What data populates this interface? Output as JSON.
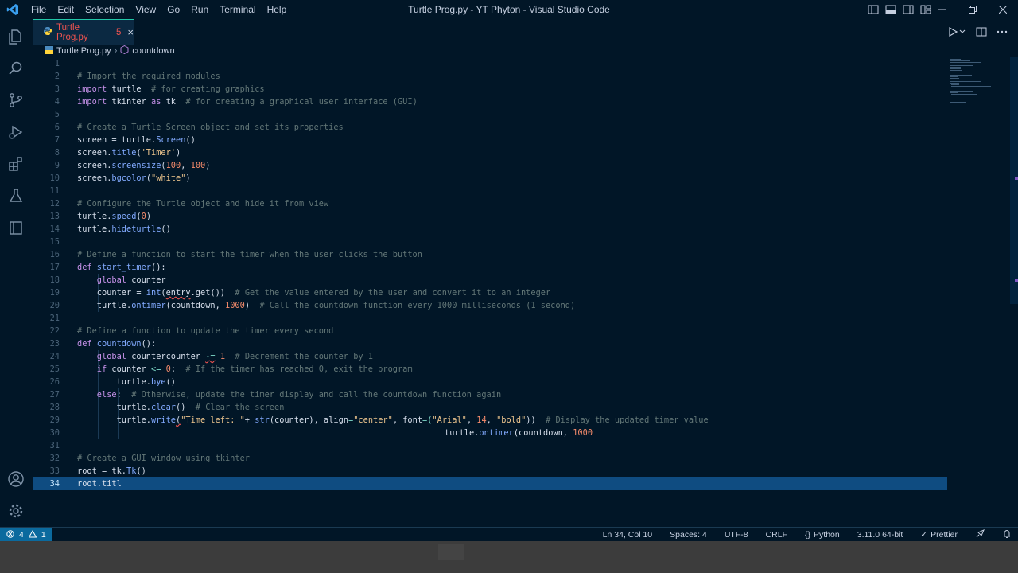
{
  "titlebar": {
    "menu": [
      "File",
      "Edit",
      "Selection",
      "View",
      "Go",
      "Run",
      "Terminal",
      "Help"
    ],
    "window_title": "Turtle Prog.py - YT Phyton - Visual Studio Code"
  },
  "tab": {
    "label": "Turtle Prog.py",
    "problems": "5"
  },
  "breadcrumb": {
    "file": "Turtle Prog.py",
    "symbol": "countdown"
  },
  "editor": {
    "line_numbers": [
      "1",
      "2",
      "3",
      "4",
      "5",
      "6",
      "7",
      "8",
      "9",
      "10",
      "11",
      "12",
      "13",
      "14",
      "15",
      "16",
      "17",
      "18",
      "19",
      "20",
      "21",
      "22",
      "23",
      "24",
      "25",
      "26",
      "27",
      "28",
      "29",
      "30",
      "31",
      "32",
      "33",
      "34"
    ],
    "lines": {
      "l2": "# Import the required modules",
      "l3a": "import",
      "l3b": " turtle ",
      "l3c": " # for creating graphics",
      "l4a": "import",
      "l4b": " tkinter ",
      "l4c": "as",
      "l4d": " tk ",
      "l4e": " # for creating a graphical user interface (GUI)",
      "l6": "# Create a Turtle Screen object and set its properties",
      "l7a": "screen = turtle.",
      "l7b": "Screen",
      "l7c": "()",
      "l8a": "screen.",
      "l8b": "title",
      "l8c": "(",
      "l8d": "'Timer'",
      "l8e": ")",
      "l9a": "screen.",
      "l9b": "screensize",
      "l9c": "(",
      "l9d": "100",
      "l9e": ", ",
      "l9f": "100",
      "l9g": ")",
      "l10a": "screen.",
      "l10b": "bgcolor",
      "l10c": "(",
      "l10d": "\"white\"",
      "l10e": ")",
      "l12": "# Configure the Turtle object and hide it from view",
      "l13a": "turtle.",
      "l13b": "speed",
      "l13c": "(",
      "l13d": "0",
      "l13e": ")",
      "l14a": "turtle.",
      "l14b": "hideturtle",
      "l14c": "()",
      "l16": "# Define a function to start the timer when the user clicks the button",
      "l17a": "def",
      "l17b": " start_timer",
      "l17c": "():",
      "l18a": "    global",
      "l18b": " counter",
      "l19a": "    counter = ",
      "l19b": "int",
      "l19c": "(",
      "l19d": "entry",
      "l19e": ".get())",
      "l19f": "  # Get the value entered by the user and convert it to an integer",
      "l20a": "    turtle.",
      "l20b": "ontimer",
      "l20c": "(countdown, ",
      "l20d": "1000",
      "l20e": ")",
      "l20f": "  # Call the countdown function every 1000 milliseconds (1 second)",
      "l22": "# Define a function to update the timer every second",
      "l23a": "def",
      "l23b": " countdown",
      "l23c": "():",
      "l24a": "    global",
      "l24b": " countercounter ",
      "l24c": "-=",
      "l24d": " ",
      "l24e": "1",
      "l24f": "  # Decrement the counter by 1",
      "l25a": "    if",
      "l25b": " counter ",
      "l25c": "<=",
      "l25d": " ",
      "l25e": "0",
      "l25f": ":",
      "l25g": "  # If the timer has reached 0, exit the program",
      "l26a": "        turtle.",
      "l26b": "bye",
      "l26c": "()",
      "l27a": "    else",
      "l27b": ":",
      "l27c": "  # Otherwise, update the timer display and call the countdown function again",
      "l28a": "        turtle.",
      "l28b": "clear",
      "l28c": "()",
      "l28d": "  # Clear the screen",
      "l29a": "        turtle.",
      "l29b": "write",
      "l29c": "(",
      "l29d": "\"Time left: \"",
      "l29e": "+ ",
      "l29f": "str",
      "l29g": "(counter), ",
      "l29h": "align",
      "l29i": "=",
      "l29j": "\"center\"",
      "l29k": ", ",
      "l29l": "font",
      "l29m": "=(",
      "l29n": "\"Arial\"",
      "l29o": ", ",
      "l29p": "14",
      "l29q": ", ",
      "l29r": "\"bold\"",
      "l29s": "))",
      "l29t": "  # Display the updated timer value",
      "l30a": "turtle.",
      "l30b": "ontimer",
      "l30c": "(countdown, ",
      "l30d": "1000",
      "l32": "# Create a GUI window using tkinter",
      "l33a": "root = tk.",
      "l33b": "Tk",
      "l33c": "()",
      "l34a": "root.titl"
    }
  },
  "statusbar": {
    "errors": "4",
    "warnings": "1",
    "position": "Ln 34, Col 10",
    "spaces": "Spaces: 4",
    "encoding": "UTF-8",
    "eol": "CRLF",
    "language": "Python",
    "interpreter": "3.11.0 64-bit",
    "formatter": "Prettier"
  },
  "colors": {
    "background": "#011627",
    "comment": "#637777",
    "keyword": "#c792ea",
    "string": "#ecc48d",
    "number": "#f78c6c",
    "function": "#82aaff",
    "status_accent": "#0b6a9e",
    "tab_label": "#ef5350"
  },
  "icons": [
    "vscode-logo-icon",
    "explorer-icon",
    "search-icon",
    "source-control-icon",
    "run-debug-icon",
    "extensions-icon",
    "testing-icon",
    "remote-icon",
    "account-icon",
    "settings-gear-icon",
    "run-icon",
    "split-editor-icon",
    "more-icon",
    "python-file-icon",
    "symbol-method-icon",
    "error-icon",
    "warning-icon",
    "feedback-icon",
    "bell-icon"
  ]
}
